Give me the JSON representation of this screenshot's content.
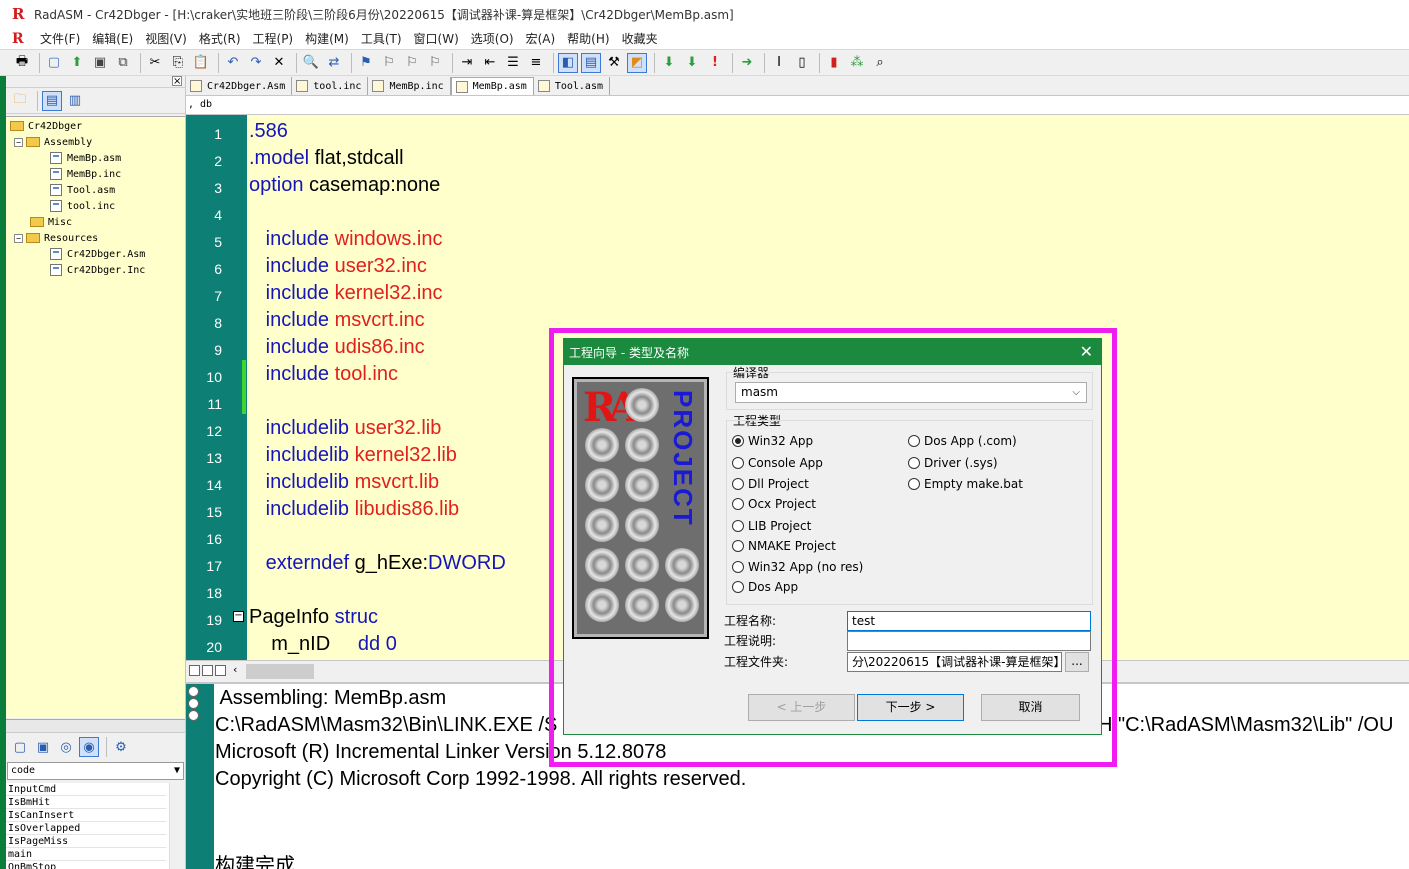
{
  "window": {
    "title": "RadASM - Cr42Dbger - [H:\\craker\\实地班三阶段\\三阶段6月份\\20220615【调试器补课-算是框架】\\Cr42Dbger\\MemBp.asm]"
  },
  "menu": [
    "文件(F)",
    "编辑(E)",
    "视图(V)",
    "格式(R)",
    "工程(P)",
    "构建(M)",
    "工具(T)",
    "窗口(W)",
    "选项(O)",
    "宏(A)",
    "帮助(H)",
    "收藏夹"
  ],
  "tabs": [
    {
      "label": "Cr42Dbger.Asm",
      "active": false
    },
    {
      "label": "tool.inc",
      "active": false
    },
    {
      "label": "MemBp.inc",
      "active": false
    },
    {
      "label": "MemBp.asm",
      "active": true
    },
    {
      "label": "Tool.asm",
      "active": false
    }
  ],
  "db_bar": ", db",
  "tree": {
    "root": "Cr42Dbger",
    "assembly": "Assembly",
    "assembly_files": [
      "MemBp.asm",
      "MemBp.inc",
      "Tool.asm",
      "tool.inc"
    ],
    "misc": "Misc",
    "resources": "Resources",
    "resource_files": [
      "Cr42Dbger.Asm",
      "Cr42Dbger.Inc"
    ]
  },
  "proc_panel": {
    "select_value": "code",
    "procs": [
      "InputCmd",
      "IsBmHit",
      "IsCanInsert",
      "IsOverlapped",
      "IsPageMiss",
      "main",
      "OnBmStop"
    ]
  },
  "editor": {
    "line_numbers": [
      "1",
      "2",
      "3",
      "4",
      "5",
      "6",
      "7",
      "8",
      "9",
      "10",
      "11",
      "12",
      "13",
      "14",
      "15",
      "16",
      "17",
      "18",
      "19",
      "20"
    ],
    "lines": [
      {
        "kw": ".586",
        "arg": ""
      },
      {
        "kw": ".model",
        "arg": " flat,stdcall"
      },
      {
        "kw": "option",
        "arg": " casemap:none"
      },
      {
        "kw": "",
        "arg": ""
      },
      {
        "kw": "   include",
        "arg": " windows.inc"
      },
      {
        "kw": "   include",
        "arg": " user32.inc"
      },
      {
        "kw": "   include",
        "arg": " kernel32.inc"
      },
      {
        "kw": "   include",
        "arg": " msvcrt.inc"
      },
      {
        "kw": "   include",
        "arg": " udis86.inc"
      },
      {
        "kw": "   include",
        "arg": " tool.inc"
      },
      {
        "kw": "",
        "arg": ""
      },
      {
        "kw": "   includelib",
        "arg": " user32.lib"
      },
      {
        "kw": "   includelib",
        "arg": " kernel32.lib"
      },
      {
        "kw": "   includelib",
        "arg": " msvcrt.lib"
      },
      {
        "kw": "   includelib",
        "arg": " libudis86.lib"
      },
      {
        "kw": "",
        "arg": ""
      },
      {
        "kw": "   externdef",
        "arg": " g_hExe:",
        "tail": "DWORD"
      },
      {
        "kw": "",
        "arg": ""
      },
      {
        "kw": "PageInfo",
        "arg": " struc"
      },
      {
        "kw": "    m_nID",
        "arg": "     dd 0"
      }
    ]
  },
  "output": {
    "lines": [
      " Assembling: MemBp.asm",
      "C:\\RadASM\\Masm32\\Bin\\LINK.EXE /S",
      "Microsoft (R) Incremental Linker Version 5.12.8078",
      "Copyright (C) Microsoft Corp 1992-1998. All rights reserved.",
      "",
      "",
      "构建完成."
    ],
    "right_fragment": "H:\"C:\\RadASM\\Masm32\\Lib\" /OU"
  },
  "dialog": {
    "title": "工程向导 - 类型及名称",
    "image_text": "PROJECT",
    "image_logo": "RA",
    "compiler_label": "编译器",
    "compiler_value": "masm",
    "project_type_label": "工程类型",
    "types_left": [
      "Win32 App",
      "Console App",
      "Dll Project",
      "Ocx Project",
      "LIB Project",
      "NMAKE Project",
      "Win32 App (no res)",
      "Dos App"
    ],
    "types_right": [
      "Dos App (.com)",
      "Driver (.sys)",
      "Empty make.bat"
    ],
    "selected_type": "Win32 App",
    "name_label": "工程名称:",
    "name_value": "test",
    "desc_label": "工程说明:",
    "desc_value": "",
    "folder_label": "工程文件夹:",
    "folder_value": "分\\20220615【调试器补课-算是框架】",
    "browse_label": "...",
    "back_button": "< 上一步",
    "next_button": "下一步 >",
    "cancel_button": "取消"
  },
  "colors": {
    "editor_bg": "#ffffcc",
    "gutter": "#0e7f75",
    "keyword": "#1515b8",
    "string": "#e01f1f",
    "dialog_title": "#1c8a3e",
    "highlight": "#f01df0"
  }
}
